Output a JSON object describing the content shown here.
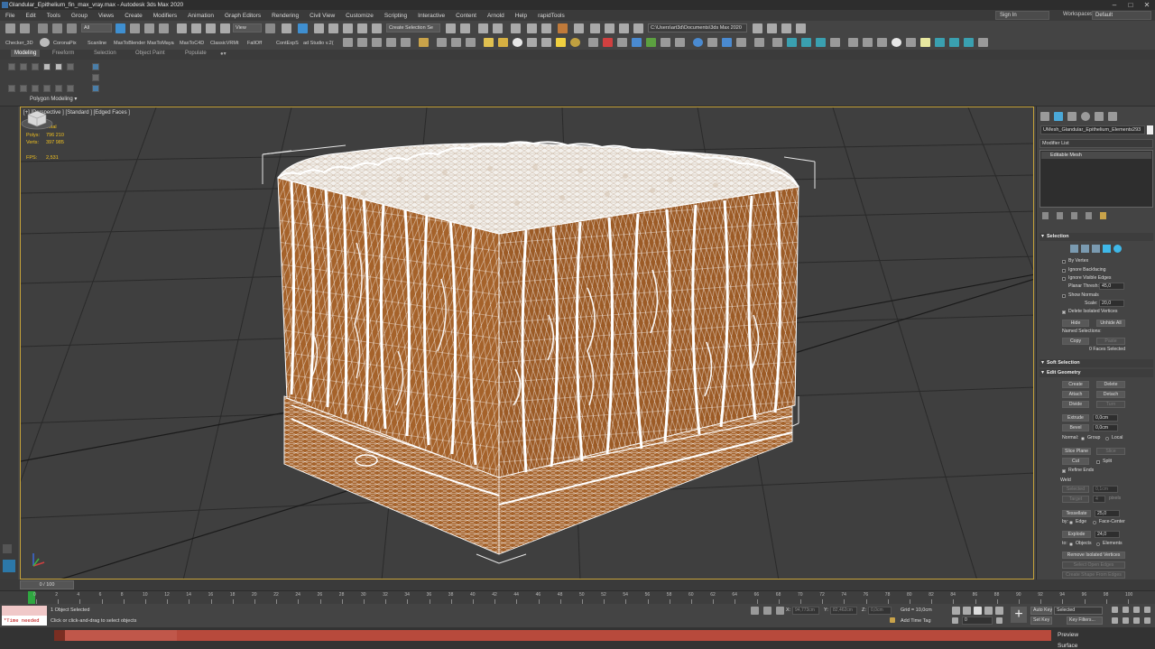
{
  "window": {
    "title": "Glandular_Epithelium_fin_max_vray.max - Autodesk 3ds Max 2020"
  },
  "menu": {
    "items": [
      "File",
      "Edit",
      "Tools",
      "Group",
      "Views",
      "Create",
      "Modifiers",
      "Animation",
      "Graph Editors",
      "Rendering",
      "Civil View",
      "Customize",
      "Scripting",
      "Interactive",
      "Content",
      "Arnold",
      "Help",
      "rapidTools"
    ],
    "signin": "Sign In",
    "workspaces_label": "Workspaces:",
    "workspace": "Default"
  },
  "toolbar": {
    "filter": "All",
    "refcoord": "View",
    "selection_set": "Create Selection Se",
    "project_path": "C:\\Users\\art3d\\Documents\\3ds Max 2020"
  },
  "plugins": [
    "Checker_3D",
    "CoronaPix",
    "Scanline",
    "MaxToBlender",
    "MaxToMaya",
    "MaxToC4D",
    "ClassicVRMt",
    "FallOff",
    "ContExpS",
    "ad Studio v.2("
  ],
  "ribbon": {
    "tabs": [
      "Modeling",
      "Freeform",
      "Selection",
      "Object Paint",
      "Populate"
    ],
    "panel_label": "Polygon Modeling ▾"
  },
  "viewport": {
    "label": "[+] [Perspective ] [Standard ] [Edged Faces ]",
    "stats": {
      "total_label": "Total",
      "polys_label": "Polys:",
      "polys": "796 210",
      "verts_label": "Verts:",
      "verts": "397 985",
      "fps_label": "FPS:",
      "fps": "2,531"
    },
    "colors": {
      "mesh": "#a5622a",
      "wire": "#ffffff",
      "grid": "#2a2a2a",
      "border": "#c6a33a"
    }
  },
  "command_panel": {
    "object_name": "UMesh_Glandular_Epithelium_Elements293",
    "modifier_list": "Modifier List",
    "stack_item": "Editable Mesh",
    "selection": {
      "title": "Selection",
      "by_vertex": "By Vertex",
      "ignore_backfacing": "Ignore Backfacing",
      "ignore_visible_edges": "Ignore Visible Edges",
      "planar_thresh_label": "Planar Thresh:",
      "planar_thresh": "45,0",
      "show_normals": "Show Normals",
      "scale_label": "Scale:",
      "scale": "20,0",
      "delete_isolated": "Delete Isolated Vertices",
      "hide": "Hide",
      "unhide_all": "Unhide All",
      "named_selections": "Named Selections:",
      "copy": "Copy",
      "paste": "Paste",
      "faces_selected": "0 Faces Selected"
    },
    "soft_selection": {
      "title": "Soft Selection"
    },
    "edit_geometry": {
      "title": "Edit Geometry",
      "create": "Create",
      "delete": "Delete",
      "attach": "Attach",
      "detach": "Detach",
      "divide": "Divide",
      "turn": "Turn",
      "extrude": "Extrude",
      "extrude_val": "0,0cm",
      "bevel": "Bevel",
      "bevel_val": "0,0cm",
      "normal_label": "Normal:",
      "group": "Group",
      "local": "Local",
      "slice_plane": "Slice Plane",
      "slice": "Slice",
      "cut": "Cut",
      "split": "Split",
      "refine_ends": "Refine Ends",
      "weld_label": "Weld",
      "selected": "Selected",
      "selected_val": "0,1cm",
      "target": "Target",
      "target_val": "4",
      "pixels": "pixels",
      "tessellate": "Tessellate",
      "tessellate_val": "25,0",
      "by_label": "by:",
      "edge": "Edge",
      "face_center": "Face-Center",
      "explode": "Explode",
      "explode_val": "24,0",
      "to_label": "to:",
      "objects": "Objects",
      "elements": "Elements",
      "remove_isolated": "Remove Isolated Vertices",
      "select_open_edges": "Select Open Edges",
      "create_shape": "Create Shape From Edges"
    }
  },
  "timeline": {
    "frame": "0 / 100",
    "ticks": [
      "0",
      "2",
      "4",
      "6",
      "8",
      "10",
      "12",
      "14",
      "16",
      "18",
      "20",
      "22",
      "24",
      "26",
      "28",
      "30",
      "32",
      "34",
      "36",
      "38",
      "40",
      "42",
      "44",
      "46",
      "48",
      "50",
      "52",
      "54",
      "56",
      "58",
      "60",
      "62",
      "64",
      "66",
      "68",
      "70",
      "72",
      "74",
      "76",
      "78",
      "80",
      "82",
      "84",
      "86",
      "88",
      "90",
      "92",
      "94",
      "96",
      "98",
      "100"
    ]
  },
  "status": {
    "listener": "*Time needed",
    "selection_msg": "1 Object Selected",
    "prompt": "Click or click-and-drag to select objects",
    "x_label": "X:",
    "x_val": "94,773cm",
    "y_label": "Y:",
    "y_val": "82,462cm",
    "z_label": "Z:",
    "z_val": "0,0cm",
    "grid": "Grid = 10,0cm",
    "add_time_tag": "Add Time Tag",
    "auto_key": "Auto Key",
    "selected_dd": "Selected",
    "set_key": "Set Key",
    "key_filters": "Key Filters...",
    "frame_val": "0"
  },
  "render": {
    "preview": "Preview",
    "surface": "Surface"
  }
}
